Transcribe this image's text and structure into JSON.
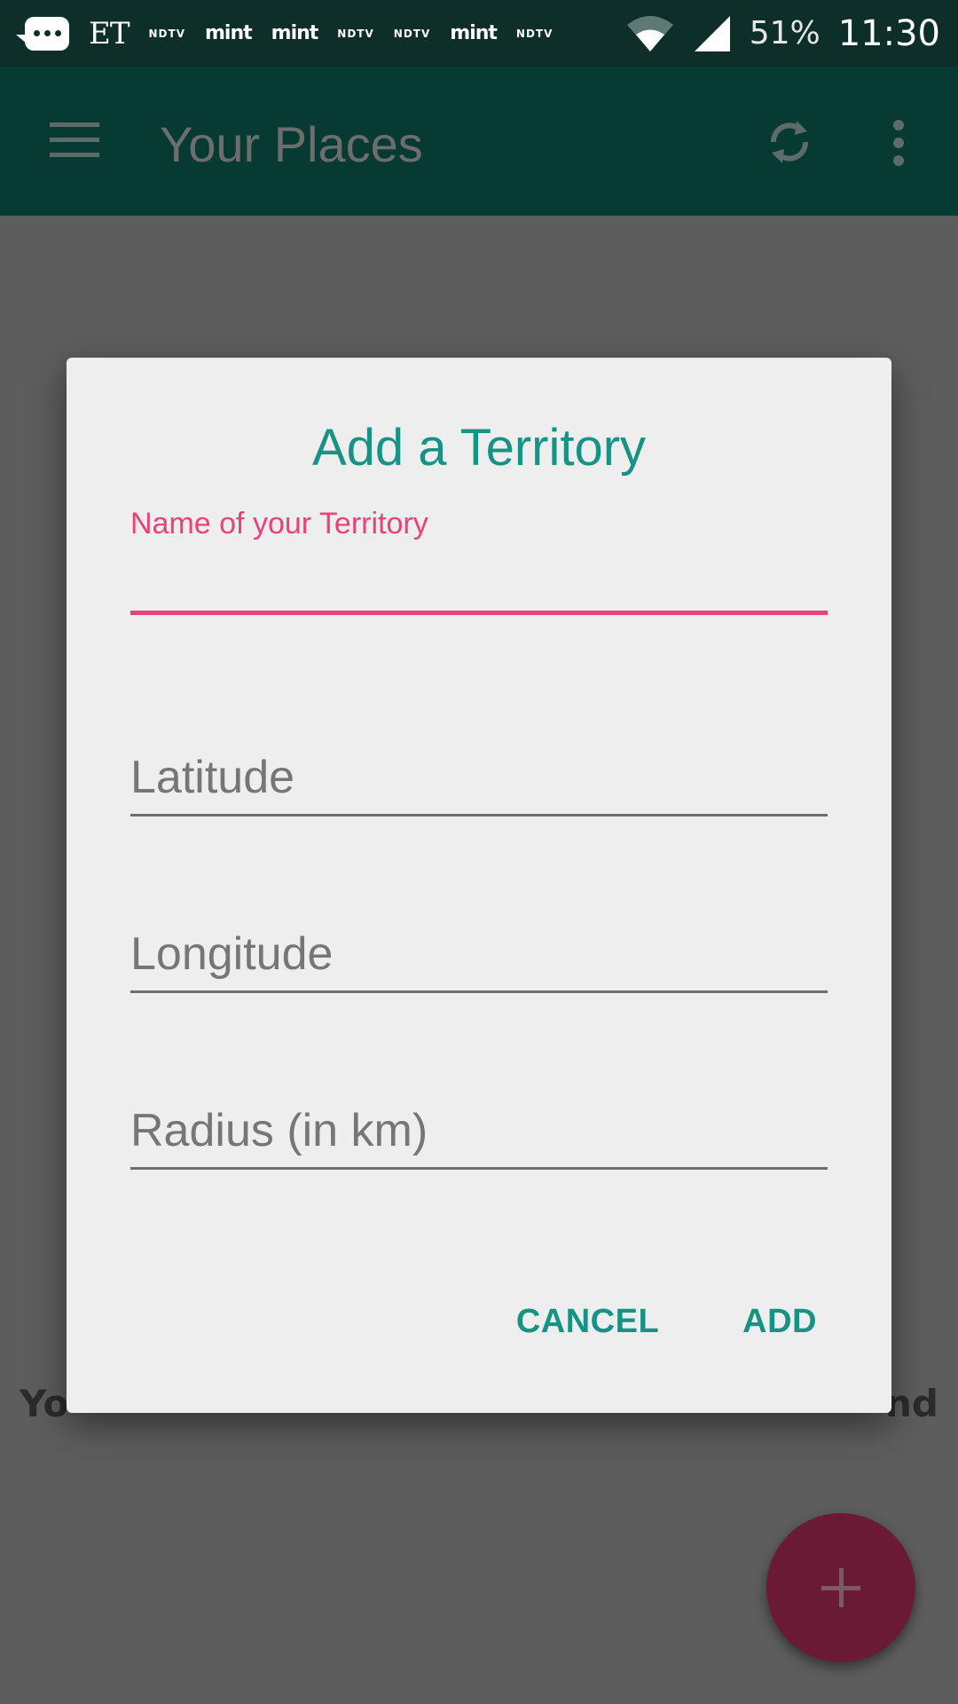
{
  "status_bar": {
    "notification_icons": [
      "chat-bubble-icon"
    ],
    "sources": [
      "ET",
      "NDTV",
      "mint",
      "mint",
      "NDTV",
      "NDTV",
      "mint",
      "NDTV"
    ],
    "battery": "51%",
    "time": "11:30"
  },
  "app_bar": {
    "title": "Your Places",
    "icons": [
      "menu-icon",
      "refresh-icon",
      "overflow-menu-icon"
    ]
  },
  "background": {
    "peek_left": "Yo",
    "peek_right": "nd",
    "fab_icon": "plus-icon"
  },
  "dialog": {
    "title": "Add a Territory",
    "fields": [
      {
        "label": "Name of your Territory",
        "value": "",
        "active": true
      },
      {
        "placeholder": "Latitude",
        "value": ""
      },
      {
        "placeholder": "Longitude",
        "value": ""
      },
      {
        "placeholder": "Radius (in km)",
        "value": ""
      }
    ],
    "cancel_label": "CANCEL",
    "add_label": "ADD"
  },
  "colors": {
    "accent": "#169384",
    "focus": "#e9427a",
    "app_bar": "#073a33",
    "fab": "#6a1a35"
  }
}
